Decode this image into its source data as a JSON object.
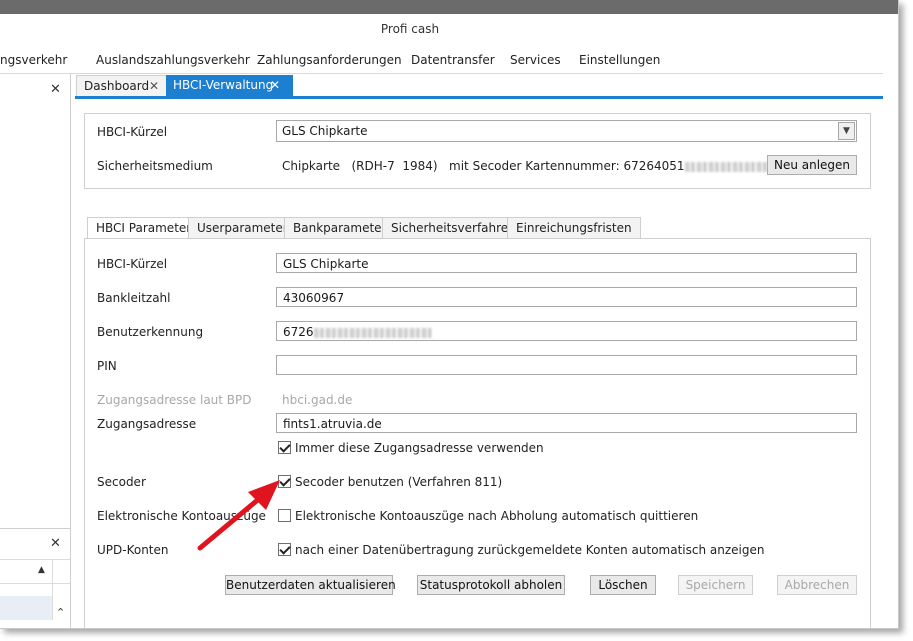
{
  "window": {
    "title": "Profi cash"
  },
  "menu": [
    "ngsverkehr",
    "Auslandszahlungsverkehr",
    "Zahlungsanforderungen",
    "Datentransfer",
    "Services",
    "Einstellungen"
  ],
  "doc_tabs": {
    "dashboard": "Dashboard",
    "hbci": "HBCI-Verwaltung",
    "close": "✕"
  },
  "top_box": {
    "kuerzel_label": "HBCI-Kürzel",
    "kuerzel_value": "GLS Chipkarte",
    "medium_label": "Sicherheitsmedium",
    "medium_value": "Chipkarte   (RDH-7  1984)   mit Secoder Kartennummer: 67264051",
    "new_button": "Neu anlegen"
  },
  "inner_tabs": [
    "HBCI Parameter",
    "Userparameter",
    "Bankparameter",
    "Sicherheitsverfahren",
    "Einreichungsfristen"
  ],
  "form": {
    "kuerzel_label": "HBCI-Kürzel",
    "kuerzel_value": "GLS Chipkarte",
    "blz_label": "Bankleitzahl",
    "blz_value": "43060967",
    "user_label": "Benutzerkennung",
    "user_value": "6726",
    "pin_label": "PIN",
    "pin_value": "",
    "bpd_label": "Zugangsadresse laut BPD",
    "bpd_value": "hbci.gad.de",
    "address_label": "Zugangsadresse",
    "address_value": "fints1.atruvia.de",
    "always_use": "Immer diese Zugangsadresse verwenden",
    "secoder_label": "Secoder",
    "secoder_check": "Secoder benutzen (Verfahren 811)",
    "ekto_label": "Elektronische Kontoauszüge",
    "ekto_check": "Elektronische Kontoauszüge nach Abholung automatisch quittieren",
    "upd_label": "UPD-Konten",
    "upd_check": "nach einer Datenübertragung zurückgemeldete Konten automatisch anzeigen"
  },
  "checks": {
    "always_use": true,
    "secoder": true,
    "ekto": false,
    "upd": true
  },
  "buttons": {
    "update": "Benutzerdaten aktualisieren",
    "status": "Statusprotokoll abholen",
    "delete": "Löschen",
    "save": "Speichern",
    "cancel": "Abbrechen"
  },
  "left_panel": {
    "close": "✕",
    "close2": "✕",
    "up": "▲",
    "scroll_up": "⌃"
  },
  "colors": {
    "accent": "#1c7fd0",
    "arrow": "#e0141e"
  }
}
